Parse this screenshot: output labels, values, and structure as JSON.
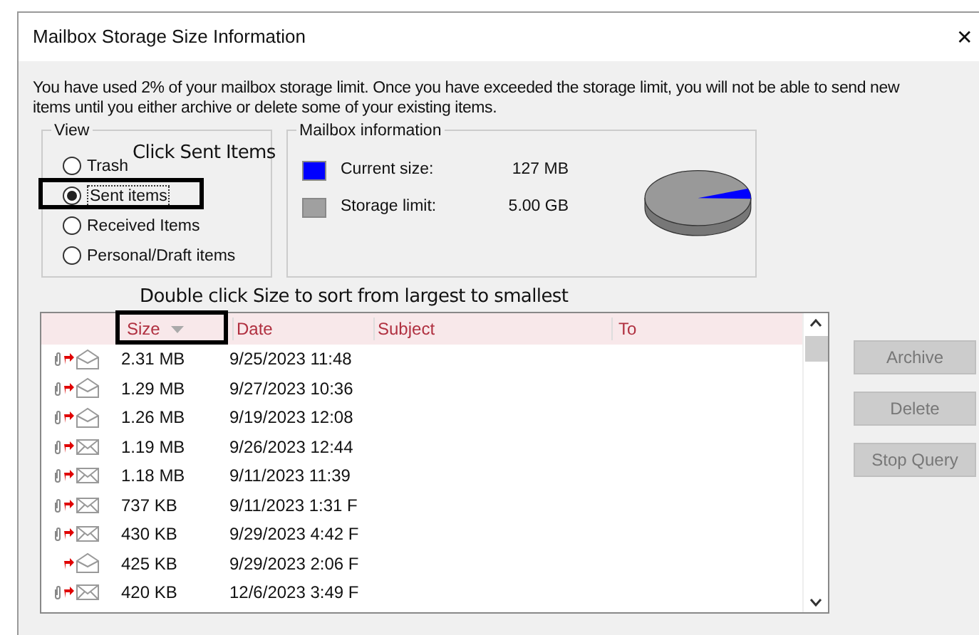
{
  "window": {
    "title": "Mailbox Storage Size Information",
    "close": "✕"
  },
  "message": "You have used 2% of your mailbox storage limit.  Once you have exceeded the storage limit, you will not be able to send new items until you either archive or delete some of your existing items.",
  "view": {
    "title": "View",
    "options": [
      {
        "label": "Trash",
        "selected": false
      },
      {
        "label": "Sent items",
        "selected": true
      },
      {
        "label": "Received Items",
        "selected": false
      },
      {
        "label": "Personal/Draft items",
        "selected": false
      }
    ]
  },
  "mailbox_info": {
    "title": "Mailbox information",
    "items": [
      {
        "label": "Current size:",
        "value": "127 MB",
        "color": "#0000ff"
      },
      {
        "label": "Storage limit:",
        "value": "5.00 GB",
        "color": "#a0a0a0"
      }
    ]
  },
  "annotations": [
    "Click Sent Items",
    "Double click Size to sort from largest to smallest"
  ],
  "table": {
    "columns": [
      {
        "label": "Size",
        "sorted": true
      },
      {
        "label": "Date",
        "sorted": false
      },
      {
        "label": "Subject",
        "sorted": false
      },
      {
        "label": "To",
        "sorted": false
      }
    ],
    "rows": [
      {
        "attachment": true,
        "opened": true,
        "size": "2.31 MB",
        "date": "9/25/2023 11:48"
      },
      {
        "attachment": true,
        "opened": true,
        "size": "1.29 MB",
        "date": "9/27/2023 10:36"
      },
      {
        "attachment": true,
        "opened": true,
        "size": "1.26 MB",
        "date": "9/19/2023 12:08"
      },
      {
        "attachment": true,
        "opened": false,
        "size": "1.19 MB",
        "date": "9/26/2023 12:44"
      },
      {
        "attachment": true,
        "opened": false,
        "size": "1.18 MB",
        "date": "9/11/2023 11:39"
      },
      {
        "attachment": true,
        "opened": false,
        "size": "737 KB",
        "date": "9/11/2023 1:31 F"
      },
      {
        "attachment": true,
        "opened": false,
        "size": "430 KB",
        "date": "9/29/2023 4:42 F"
      },
      {
        "attachment": false,
        "opened": true,
        "size": "425 KB",
        "date": "9/29/2023 2:06 F"
      },
      {
        "attachment": true,
        "opened": false,
        "size": "420 KB",
        "date": "12/6/2023 3:49 F"
      }
    ]
  },
  "buttons": [
    {
      "label": "Archive",
      "disabled": true
    },
    {
      "label": "Delete",
      "disabled": true
    },
    {
      "label": "Stop Query",
      "disabled": true
    }
  ]
}
